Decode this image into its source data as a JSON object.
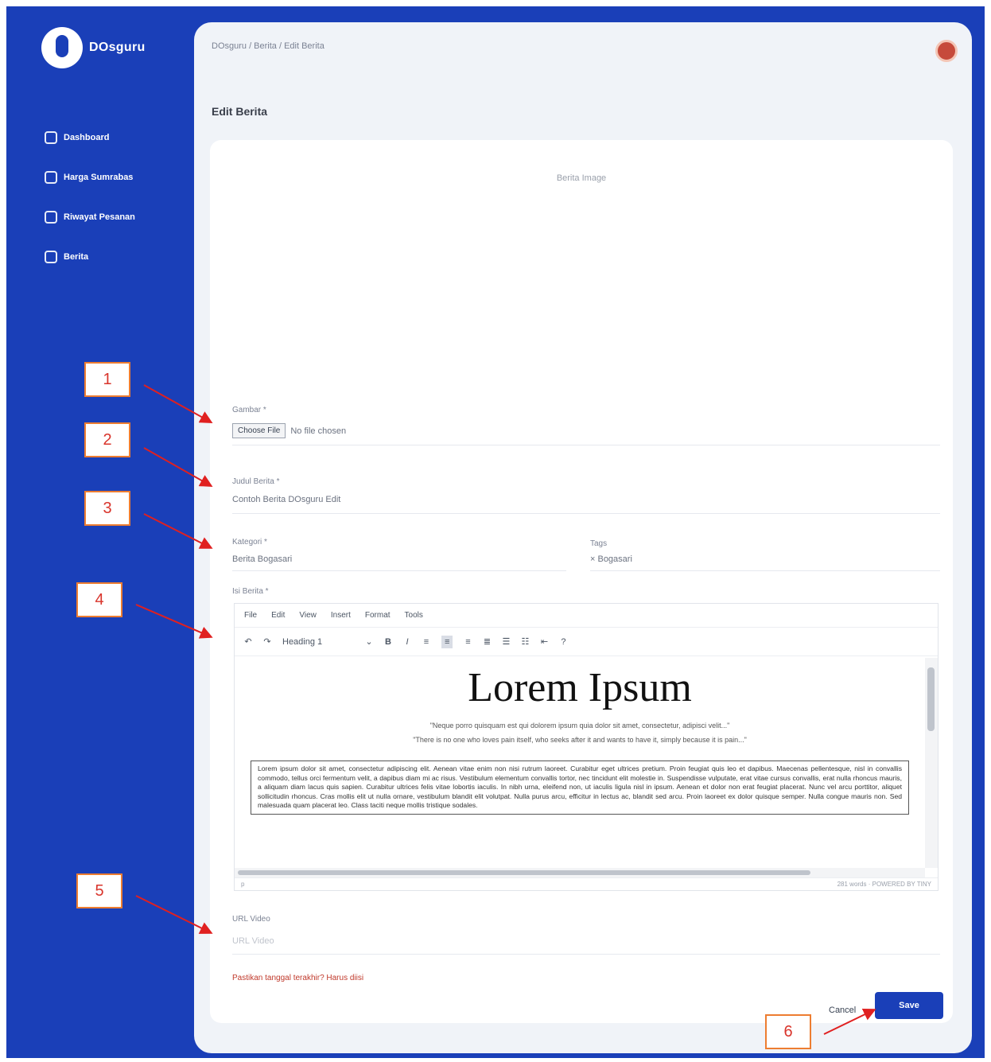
{
  "sidebar": {
    "brand": "DOsguru",
    "items": [
      {
        "label": "Dashboard",
        "icon": "home-icon"
      },
      {
        "label": "Harga Sumrabas",
        "icon": "tag-icon"
      },
      {
        "label": "Riwayat Pesanan",
        "icon": "history-icon"
      },
      {
        "label": "Berita",
        "icon": "newspaper-icon"
      }
    ]
  },
  "breadcrumb": "DOsguru / Berita / Edit Berita",
  "page_title": "Edit Berita",
  "form": {
    "preview_label": "Berita Image",
    "thumbnail_label": "Gambar *",
    "file_button": "Choose File",
    "file_status": "No file chosen",
    "title_label": "Judul Berita *",
    "title_value": "Contoh Berita DOsguru Edit",
    "category_label": "Kategori *",
    "category_value": "Berita Bogasari",
    "tags_label": "Tags",
    "tags_value": "× Bogasari",
    "content_label": "Isi Berita *",
    "url_label": "URL Video",
    "url_placeholder": "URL Video",
    "note": "Pastikan tanggal terakhir? Harus diisi",
    "cancel_label": "Cancel",
    "save_label": "Save"
  },
  "editor": {
    "menu": [
      "File",
      "Edit",
      "View",
      "Insert",
      "Format",
      "Tools"
    ],
    "block_format": "Heading 1",
    "title": "Lorem Ipsum",
    "quote_1": "\"Neque porro quisquam est qui dolorem ipsum quia dolor sit amet, consectetur, adipisci velit...\"",
    "quote_2": "\"There is no one who loves pain itself, who seeks after it and wants to have it, simply because it is pain...\"",
    "paragraph": "Lorem ipsum dolor sit amet, consectetur adipiscing elit. Aenean vitae enim non nisi rutrum laoreet. Curabitur eget ultrices pretium. Proin feugiat quis leo et dapibus. Maecenas pellentesque, nisl in convallis commodo, tellus orci fermentum velit, a dapibus diam mi ac risus. Vestibulum elementum convallis tortor, nec tincidunt elit molestie in. Suspendisse vulputate, erat vitae cursus convallis, erat nulla rhoncus mauris, a aliquam diam lacus quis sapien. Curabitur ultrices felis vitae lobortis iaculis. In nibh urna, eleifend non, ut iaculis ligula nisl in ipsum. Aenean et dolor non erat feugiat placerat. Nunc vel arcu porttitor, aliquet sollicitudin rhoncus. Cras mollis elit ut nulla ornare, vestibulum blandit elit volutpat. Nulla purus arcu, efficitur in lectus ac, blandit sed arcu. Proin laoreet ex dolor quisque semper. Nulla congue mauris non. Sed malesuada quam placerat leo. Class taciti neque mollis tristique sodales.",
    "status_left": "p",
    "status_right": "281 words · POWERED BY TINY"
  },
  "annotations": [
    "1",
    "2",
    "3",
    "4",
    "5",
    "6"
  ],
  "colors": {
    "primary": "#1a3fb8",
    "annotation_border": "#ed7d31",
    "annotation_text": "#d9342b",
    "arrow": "#e02020"
  }
}
